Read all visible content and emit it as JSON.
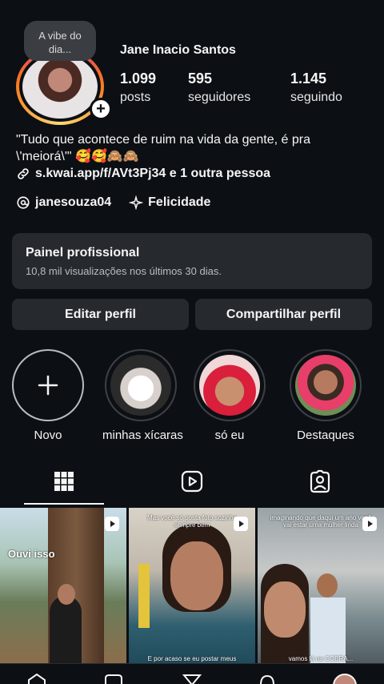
{
  "profile": {
    "note": "A vibe do dia...",
    "name": "Jane Inacio Santos",
    "stats": [
      {
        "value": "1.099",
        "label": "posts"
      },
      {
        "value": "595",
        "label": "seguidores"
      },
      {
        "value": "1.145",
        "label": "seguindo"
      }
    ],
    "bio": "\"Tudo que acontece de ruim na vida da gente, é pra \\'meiorá\\'\" 🥰🥰🙈🙈",
    "link": "s.kwai.app/f/AVt3Pj34 e 1 outra pessoa",
    "threads_handle": "janesouza04",
    "category": "Felicidade"
  },
  "panel": {
    "title": "Painel profissional",
    "subtitle": "10,8 mil visualizações nos últimos 30 dias."
  },
  "buttons": {
    "edit": "Editar perfil",
    "share": "Compartilhar perfil"
  },
  "highlights": [
    {
      "label": "Novo"
    },
    {
      "label": "minhas xícaras"
    },
    {
      "label": "só eu"
    },
    {
      "label": "Destaques"
    }
  ],
  "tabs": [
    "grid-icon",
    "reels-icon",
    "tagged-icon"
  ],
  "grid": [
    {
      "caption": "Ouvi isso"
    },
    {
      "caption_top": "Mas você só posta foto sozinha sempre bem",
      "caption_bottom": "E por acaso se eu postar meus"
    },
    {
      "caption_top": "imaginando que daqui um ano você vai estar uma mulher linda",
      "caption_bottom": "vamos lá na COBRA..."
    }
  ],
  "colors": {
    "background": "#0c1014",
    "panel": "#262a2f",
    "text": "#f5f5f5",
    "muted": "#b9bcc0"
  }
}
